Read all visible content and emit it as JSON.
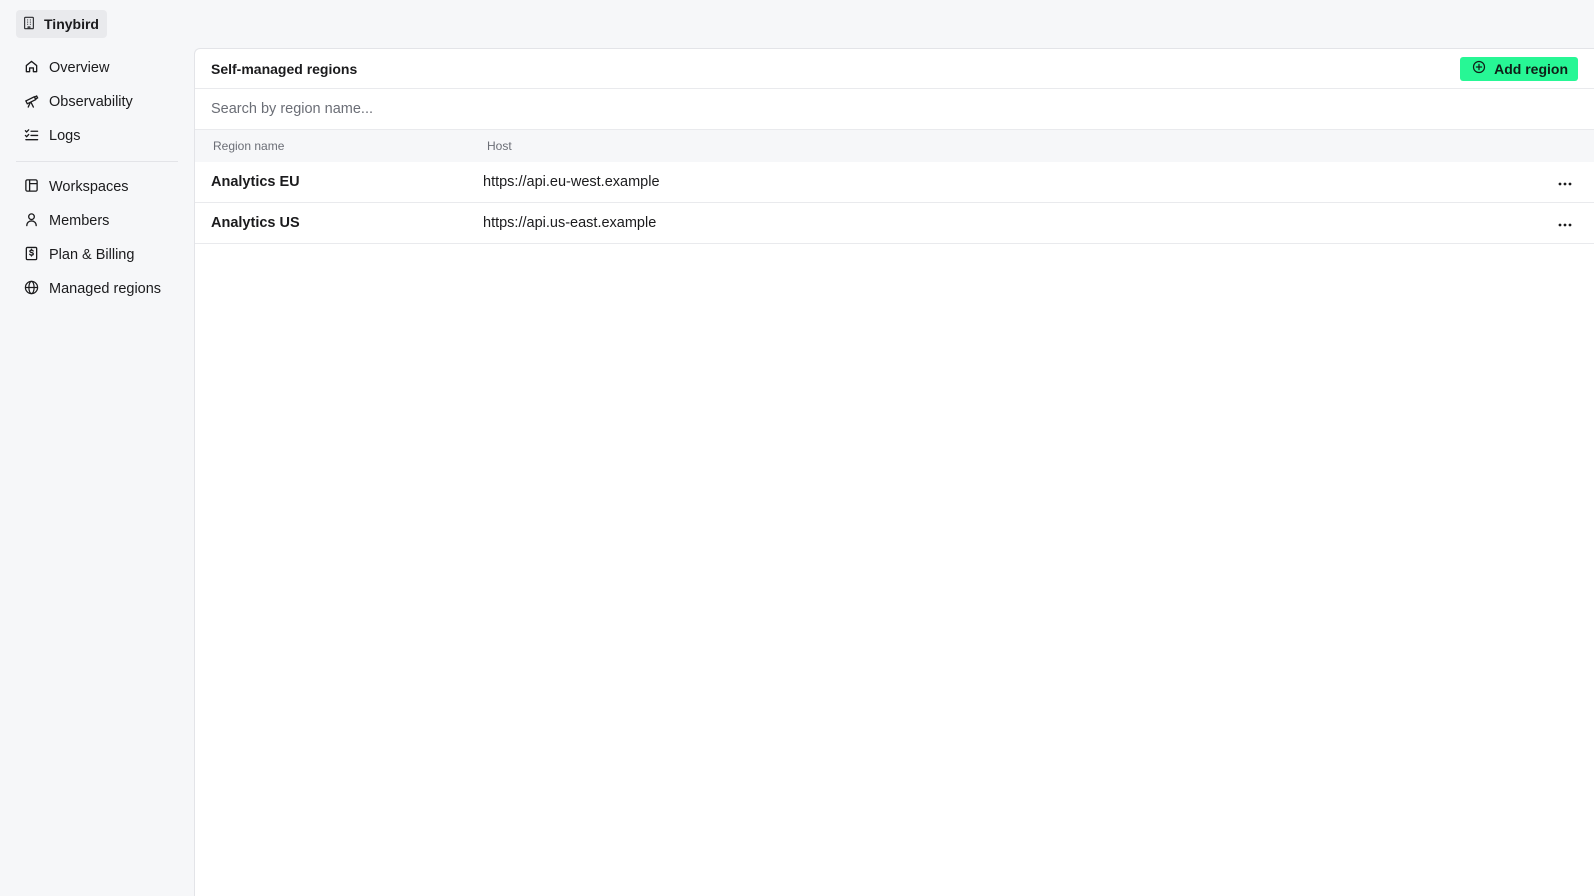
{
  "org": {
    "name": "Tinybird",
    "icon": "building-icon"
  },
  "sidebar": {
    "primary": [
      {
        "label": "Overview",
        "icon": "home-icon"
      },
      {
        "label": "Observability",
        "icon": "telescope-icon"
      },
      {
        "label": "Logs",
        "icon": "list-check-icon"
      }
    ],
    "secondary": [
      {
        "label": "Workspaces",
        "icon": "layout-icon"
      },
      {
        "label": "Members",
        "icon": "user-icon"
      },
      {
        "label": "Plan & Billing",
        "icon": "receipt-dollar-icon"
      },
      {
        "label": "Managed regions",
        "icon": "globe-icon"
      }
    ]
  },
  "main": {
    "title": "Self-managed regions",
    "add_button": "Add region",
    "search_placeholder": "Search by region name...",
    "columns": [
      "Region name",
      "Host"
    ],
    "rows": [
      {
        "name": "Analytics EU",
        "host": "https://api.eu-west.example"
      },
      {
        "name": "Analytics US",
        "host": "https://api.us-east.example"
      }
    ]
  },
  "colors": {
    "accent": "#27f795",
    "background": "#f6f7f9",
    "panel": "#ffffff",
    "border": "#e3e4e8"
  }
}
